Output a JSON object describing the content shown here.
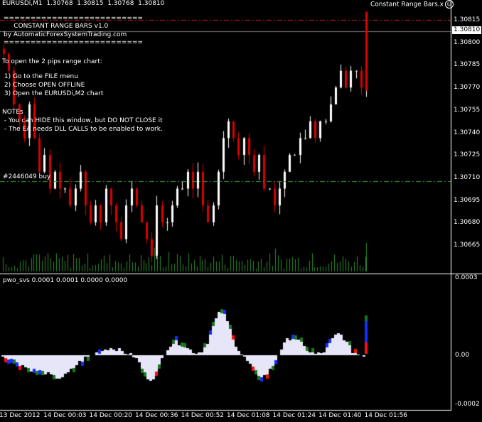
{
  "header": {
    "symbol_line": "EURUSDi,M1  1.30768  1.30815  1.30768  1.30810",
    "ea_name": "Constant Range Bars.x",
    "ea_icon": "smiley-icon"
  },
  "comment": {
    "sep1": "==========================",
    "title": "     CONSTANT RANGE BARS v1.0",
    "sep2": "==========================",
    "by": "by AutomaticForexSystemTrading.com",
    "sep3": "==========================",
    "open_title": "To open the 2 pips range chart:",
    "step1": " 1) Go to the FILE menu",
    "step2": " 2) Choose OPEN OFFLINE",
    "step3": " 3) Open the EURUSDi,M2 chart",
    "notes_title": "NOTEs",
    "note1": " - You can HIDE this window, but DO NOT CLOSE it",
    "note2": " - The EA needs DLL CALLS to be enabled to work."
  },
  "order_label": "#2446049 buy",
  "indicator_label": "pwo_svs 0.0001 0.0001 0.0000 0.0000",
  "price_axis": {
    "labels": [
      "1.30815",
      "1.30800",
      "1.30785",
      "1.30770",
      "1.30755",
      "1.30740",
      "1.30725",
      "1.30710",
      "1.30695",
      "1.30680",
      "1.30665"
    ],
    "current": "1.30810"
  },
  "indicator_axis": {
    "labels": [
      "0.0003",
      "0.00",
      "-0.0002"
    ]
  },
  "time_axis": {
    "labels": [
      "13 Dec 2012",
      "14 Dec 00:03",
      "14 Dec 00:20",
      "14 Dec 00:36",
      "14 Dec 00:52",
      "14 Dec 01:08",
      "14 Dec 01:24",
      "14 Dec 01:40",
      "14 Dec 01:56"
    ]
  },
  "colors": {
    "bull": "#ffffff",
    "bear": "#dd0000",
    "volume": "#2e8b2e",
    "order_line": "#3c9a3c",
    "price_line": "#cc2020",
    "grid_line": "#c0c0c0",
    "hist_body": "#e6e6f8",
    "hist_blue": "#1430ff",
    "hist_green": "#1a7a1a",
    "hist_red": "#ff1010"
  },
  "chart_data": {
    "type": "candlestick",
    "symbol": "EURUSDi",
    "timeframe": "M1",
    "last": {
      "open": 1.30768,
      "high": 1.30815,
      "low": 1.30768,
      "close": 1.3081
    },
    "order_level": 1.30717,
    "ylim": [
      1.3066,
      1.30822
    ],
    "closes": [
      1.3079,
      1.3078,
      1.3076,
      1.3075,
      1.3074,
      1.3076,
      1.3074,
      1.3072,
      1.3073,
      1.3071,
      1.3072,
      1.3071,
      1.3071,
      1.307,
      1.3071,
      1.3072,
      1.307,
      1.3069,
      1.307,
      1.3069,
      1.3071,
      1.307,
      1.3069,
      1.3068,
      1.307,
      1.3071,
      1.307,
      1.3069,
      1.3068,
      1.3067,
      1.307,
      1.3069,
      1.3069,
      1.307,
      1.3071,
      1.3071,
      1.3072,
      1.3071,
      1.3072,
      1.307,
      1.3069,
      1.307,
      1.3072,
      1.3074,
      1.3075,
      1.3074,
      1.3073,
      1.3074,
      1.3073,
      1.3072,
      1.3073,
      1.3071,
      1.3071,
      1.307,
      1.3071,
      1.3072,
      1.3073,
      1.3073,
      1.3074,
      1.3074,
      1.3075,
      1.3074,
      1.3075,
      1.3075,
      1.3076,
      1.3077,
      1.3078,
      1.3077,
      1.3078,
      1.3078,
      1.3077,
      1.3081
    ],
    "indicator_ylim": [
      -0.0002,
      0.0003
    ]
  }
}
